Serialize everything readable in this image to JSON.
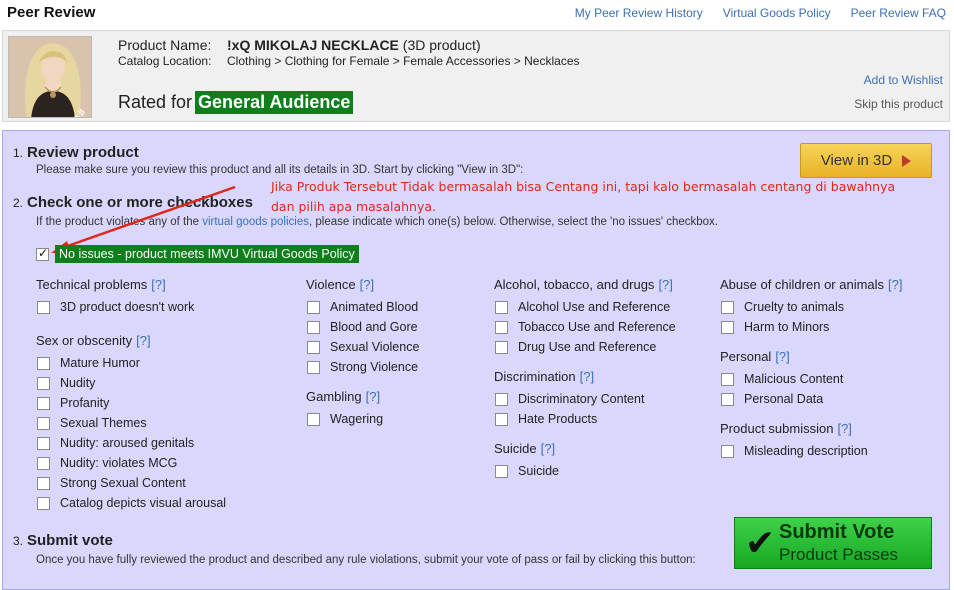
{
  "header": {
    "title": "Peer Review",
    "links": [
      "My Peer Review History",
      "Virtual Goods Policy",
      "Peer Review FAQ"
    ]
  },
  "product": {
    "name_label": "Product Name:",
    "name": "!xQ MIKOLAJ NECKLACE",
    "type": "(3D product)",
    "catalog_label": "Catalog Location:",
    "catalog_path": "Clothing > Clothing for Female > Female Accessories > Necklaces",
    "rated_label": "Rated for",
    "rating": "General Audience",
    "wishlist": "Add to Wishlist",
    "skip": "Skip this product",
    "thumb_watermark": "xQ&#"
  },
  "colors": {
    "rating_badge": "#0e7f1c",
    "main_bg": "#d9d8fc",
    "link": "#3b6fb6",
    "annotation": "#e0261a"
  },
  "step1": {
    "num": "1.",
    "title": "Review product",
    "desc": "Please make sure you review this product and all its details in 3D. Start by clicking \"View in 3D\":",
    "button": "View in 3D",
    "button_icon": "play-triangle-icon"
  },
  "step2": {
    "num": "2.",
    "title": "Check one or more checkboxes",
    "desc_pre": "If the product violates any of the ",
    "desc_link": "virtual goods policies",
    "desc_post": ", please indicate which one(s) below. Otherwise, select the 'no issues' checkbox.",
    "no_issues": "No issues - product meets IMVU Virtual Goods Policy",
    "help": "[?]"
  },
  "annotation": {
    "line1": "Jika Produk Tersebut Tidak bermasalah bisa Centang ini, tapi kalo bermasalah centang di bawahnya",
    "line2": "dan pilih apa masalahnya."
  },
  "categories": {
    "technical": {
      "title": "Technical problems",
      "items": [
        "3D product doesn't work"
      ]
    },
    "sex": {
      "title": "Sex or obscenity",
      "items": [
        "Mature Humor",
        "Nudity",
        "Profanity",
        "Sexual Themes",
        "Nudity: aroused genitals",
        "Nudity: violates MCG",
        "Strong Sexual Content",
        "Catalog depicts visual arousal"
      ]
    },
    "violence": {
      "title": "Violence",
      "items": [
        "Animated Blood",
        "Blood and Gore",
        "Sexual Violence",
        "Strong Violence"
      ]
    },
    "gambling": {
      "title": "Gambling",
      "items": [
        "Wagering"
      ]
    },
    "alcohol": {
      "title": "Alcohol, tobacco, and drugs",
      "items": [
        "Alcohol Use and Reference",
        "Tobacco Use and Reference",
        "Drug Use and Reference"
      ]
    },
    "discrimination": {
      "title": "Discrimination",
      "items": [
        "Discriminatory Content",
        "Hate Products"
      ]
    },
    "suicide": {
      "title": "Suicide",
      "items": [
        "Suicide"
      ]
    },
    "abuse": {
      "title": "Abuse of children or animals",
      "items": [
        "Cruelty to animals",
        "Harm to Minors"
      ]
    },
    "personal": {
      "title": "Personal",
      "items": [
        "Malicious Content",
        "Personal Data"
      ]
    },
    "submission": {
      "title": "Product submission",
      "items": [
        "Misleading description"
      ]
    }
  },
  "step3": {
    "num": "3.",
    "title": "Submit vote",
    "desc": "Once you have fully reviewed the product and described any rule violations, submit your vote of pass or fail by clicking this button:",
    "button_line1": "Submit Vote",
    "button_line2": "Product Passes",
    "button_icon": "checkmark-icon"
  }
}
